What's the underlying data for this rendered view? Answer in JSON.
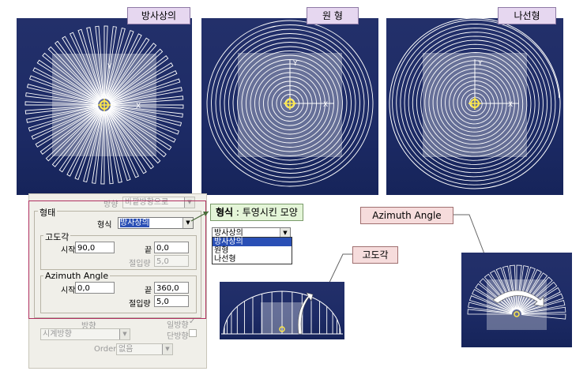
{
  "views": {
    "radial_title": "방사상의",
    "circle_title": "원 형",
    "spiral_title": "나선형"
  },
  "axis": {
    "x": "X",
    "y": "Y",
    "z": "Z"
  },
  "panel": {
    "direction_label": "방향",
    "direction_value": "바깥방향으로",
    "shape_group": "형태",
    "type_label": "형식",
    "type_value": "방사상의",
    "altitude_group": "고도각",
    "start_label": "시작",
    "start_value": "90,0",
    "end_label": "끝",
    "end_value": "0,0",
    "increment_label": "절입량",
    "increment_value": "5,0",
    "azimuth_group": "Azimuth Angle",
    "az_start_label": "시작",
    "az_start_value": "0,0",
    "az_end_label": "끝",
    "az_end_value": "360,0",
    "az_increment_label": "절입량",
    "az_increment_value": "5,0",
    "dir2_label": "방향",
    "dir2_value": "시계방향",
    "one_way_label": "일방향",
    "single_label": "단방향",
    "order_label": "Order",
    "order_value": "없음"
  },
  "callout": {
    "bold": "형식",
    "text": " : 투영시킨 모양"
  },
  "dropdown": {
    "selected": "방사상의",
    "options": [
      "방사상의",
      "원형",
      "나선형"
    ]
  },
  "labels": {
    "altitude": "고도각",
    "azimuth": "Azimuth Angle"
  }
}
